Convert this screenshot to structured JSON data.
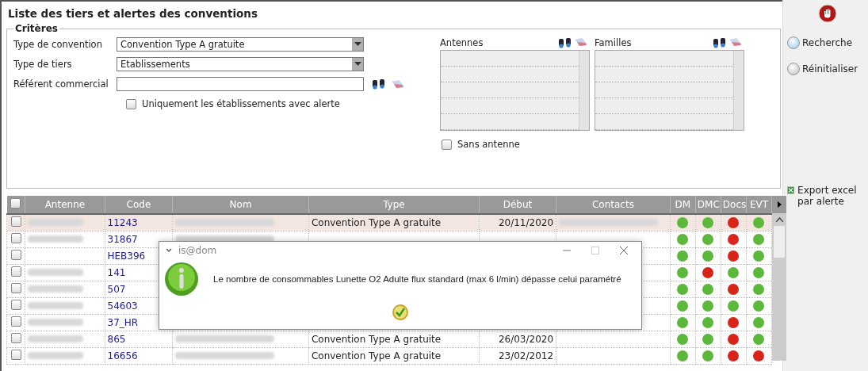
{
  "title": "Liste des tiers et alertes des conventions",
  "criteria": {
    "legend": "Critères",
    "fields": [
      {
        "label": "Type de convention",
        "kind": "select",
        "value": "Convention Type A gratuite"
      },
      {
        "label": "Type de tiers",
        "kind": "select",
        "value": "Etablissements"
      },
      {
        "label": "Référent commercial",
        "kind": "lookup"
      }
    ],
    "alert_only": {
      "label": "Uniquement les établissements avec alerte",
      "checked": false
    },
    "lists": [
      {
        "label": "Antennes"
      },
      {
        "label": "Familles"
      }
    ],
    "no_antenna": {
      "label": "Sans antenne",
      "checked": false
    }
  },
  "actions": [
    {
      "label": "Recherche",
      "kind": "search"
    },
    {
      "label": "Réinitialiser",
      "kind": "reset"
    }
  ],
  "export": {
    "label": "Export excel par alerte"
  },
  "table": {
    "all_checked": false,
    "columns": [
      "Antenne",
      "Code",
      "Nom",
      "Type",
      "Début",
      "Contacts",
      "DM",
      "DMC",
      "Docs",
      "EVT"
    ],
    "rows": [
      {
        "selected": true,
        "checked": false,
        "antenne_blurred": true,
        "code": "11243",
        "contacts_blurred": true,
        "type": "Convention Type A gratuite",
        "debut": "20/11/2020",
        "status": [
          {
            "color": "#5cb83a"
          },
          {
            "color": "#5cb83a"
          },
          {
            "color": "#d8251a"
          },
          {
            "color": "#5cb83a"
          }
        ]
      },
      {
        "selected": false,
        "checked": false,
        "antenne_blurred": true,
        "code": "31867",
        "contacts_blurred": false,
        "status": [
          {
            "color": "#5cb83a"
          },
          {
            "color": "#5cb83a"
          },
          {
            "color": "#d8251a"
          },
          {
            "color": "#5cb83a"
          }
        ]
      },
      {
        "selected": false,
        "checked": false,
        "antenne_blurred": false,
        "code": "HEB396",
        "nom_hidden": true,
        "contacts_blurred": false,
        "status": [
          {
            "color": "#5cb83a"
          },
          {
            "color": "#5cb83a"
          },
          {
            "color": "#d8251a"
          },
          {
            "color": "#5cb83a"
          }
        ]
      },
      {
        "selected": false,
        "checked": false,
        "antenne_blurred": true,
        "code": "141",
        "nom_hidden": true,
        "contacts_blurred": false,
        "status": [
          {
            "color": "#5cb83a"
          },
          {
            "color": "#d8251a"
          },
          {
            "color": "#5cb83a"
          },
          {
            "color": "#5cb83a"
          }
        ]
      },
      {
        "selected": false,
        "checked": false,
        "antenne_blurred": true,
        "code": "507",
        "nom_hidden": true,
        "contacts_blurred": false,
        "status": [
          {
            "color": "#5cb83a"
          },
          {
            "color": "#5cb83a"
          },
          {
            "color": "#d8251a"
          },
          {
            "color": "#5cb83a"
          }
        ]
      },
      {
        "selected": false,
        "checked": false,
        "antenne_blurred": true,
        "code": "54603",
        "nom_hidden": true,
        "contacts_blurred": false,
        "status": [
          {
            "color": "#5cb83a"
          },
          {
            "color": "#5cb83a"
          },
          {
            "color": "#5cb83a"
          },
          {
            "color": "#5cb83a"
          }
        ]
      },
      {
        "selected": false,
        "checked": false,
        "antenne_blurred": true,
        "code": "37_HR",
        "nom_hidden": true,
        "contacts_blurred": false,
        "status": [
          {
            "color": "#5cb83a"
          },
          {
            "color": "#5cb83a"
          },
          {
            "color": "#d8251a"
          },
          {
            "color": "#5cb83a"
          }
        ]
      },
      {
        "selected": false,
        "checked": false,
        "antenne_blurred": true,
        "code": "865",
        "contacts_blurred": false,
        "type": "Convention Type A gratuite",
        "debut": "26/03/2020",
        "status": [
          {
            "color": "#5cb83a"
          },
          {
            "color": "#5cb83a"
          },
          {
            "color": "#d8251a"
          },
          {
            "color": "#5cb83a"
          }
        ]
      },
      {
        "selected": false,
        "checked": false,
        "antenne_blurred": true,
        "code": "16656",
        "contacts_blurred": false,
        "type": "Convention Type A gratuite",
        "debut": "23/02/2012",
        "status": [
          {
            "color": "#5cb83a"
          },
          {
            "color": "#5cb83a"
          },
          {
            "color": "#d8251a"
          },
          {
            "color": "#d8251a"
          }
        ]
      }
    ]
  },
  "dialog": {
    "title": "is@dom",
    "message": "Le nombre de consommables Lunette O2 Adulte flux standard (max 6 l/min) dépasse celui paramétré"
  }
}
